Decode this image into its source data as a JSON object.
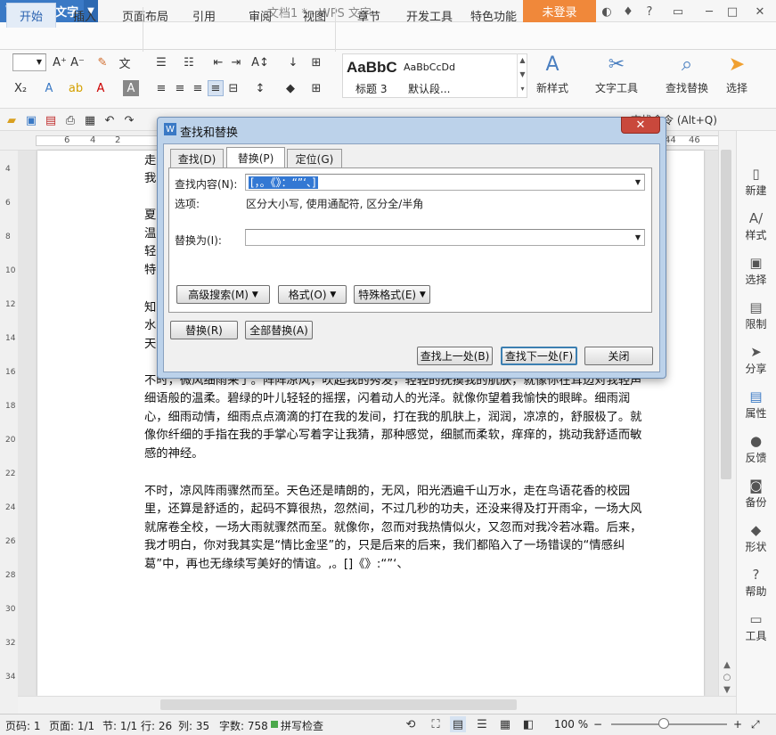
{
  "app": {
    "name": "WPS 文字",
    "doc_title": "文档1 * - WPS 文字",
    "login": "未登录",
    "logo": "W"
  },
  "menu": [
    "开始",
    "插入",
    "页面布局",
    "引用",
    "审阅",
    "视图",
    "章节",
    "开发工具",
    "特色功能"
  ],
  "ribbon": {
    "styles": {
      "sample_big": "AaBbC",
      "sample_small": "AaBbCcDd",
      "name1": "标题 3",
      "name2": "默认段..."
    },
    "tools": [
      "新样式",
      "文字工具",
      "查找替换",
      "选择"
    ]
  },
  "quickbar": {
    "search_cmd": "查找命令 (Alt+Q)"
  },
  "ruler": {
    "left_nums": [
      "6",
      "4",
      "2"
    ],
    "right_nums": [
      "42",
      "44",
      "46"
    ]
  },
  "vruler": [
    "4",
    "6",
    "8",
    "10",
    "12",
    "14",
    "16",
    "18",
    "20",
    "22",
    "24",
    "26",
    "28",
    "30",
    "32",
    "34"
  ],
  "document": {
    "left_chars": [
      "走",
      "我",
      "夏",
      "温",
      "轻",
      "特",
      "知",
      "水",
      "天"
    ],
    "paragraphs": [
      "不时，微风细雨来了。阵阵凉风，吹起我的秀发，轻轻的抚摸我的肌肤，就像你在耳边对我轻声细语般的温柔。碧绿的叶儿轻轻的摇摆，闪着动人的光泽。就像你望着我愉快的眼眸。细雨润心，细雨动情，细雨点点滴滴的打在我的发间，打在我的肌肤上，润润，凉凉的，舒服极了。就像你纤细的手指在我的手掌心写着字让我猜，那种感觉，细腻而柔软，痒痒的，挑动我舒适而敏感的神经。",
      "不时，凉风阵雨骤然而至。天色还是晴朗的，无风，阳光洒遍千山万水，走在鸟语花香的校园里，还算是舒适的，起码不算很热，忽然间，不过几秒的功夫，还没来得及打开雨伞，一场大风就席卷全校，一场大雨就骤然而至。就像你，忽而对我热情似火，又忽而对我冷若冰霜。后来，我才明白，你对我其实是“情比金坚”的，只是后来的后来，我们都陷入了一场错误的“情感纠葛”中，再也无缘续写美好的情谊。,。[]《》:“”‘、"
    ]
  },
  "sidebar": [
    "新建",
    "样式",
    "选择",
    "限制",
    "分享",
    "属性",
    "反馈",
    "备份",
    "形状",
    "帮助",
    "工具"
  ],
  "status": {
    "page_code": "页码: 1",
    "page": "页面: 1/1",
    "section": "节: 1/1",
    "row": "行: 26",
    "col": "列: 35",
    "words": "字数: 758",
    "spell": "拼写检查",
    "zoom": "100 %",
    "zoom_level": 0.45
  },
  "dialog": {
    "title": "查找和替换",
    "tabs": [
      "查找(D)",
      "替换(P)",
      "定位(G)"
    ],
    "find_label": "查找内容(N):",
    "find_value": "[，。《》：“”‘、]",
    "options_label": "选项:",
    "options_value": "区分大小写, 使用通配符, 区分全/半角",
    "replace_label": "替换为(I):",
    "replace_value": "",
    "adv_search": "高级搜索(M)",
    "format": "格式(O)",
    "special": "特殊格式(E)",
    "btn_replace": "替换(R)",
    "btn_replace_all": "全部替换(A)",
    "btn_prev": "查找上一处(B)",
    "btn_next": "查找下一处(F)",
    "btn_close": "关闭"
  }
}
